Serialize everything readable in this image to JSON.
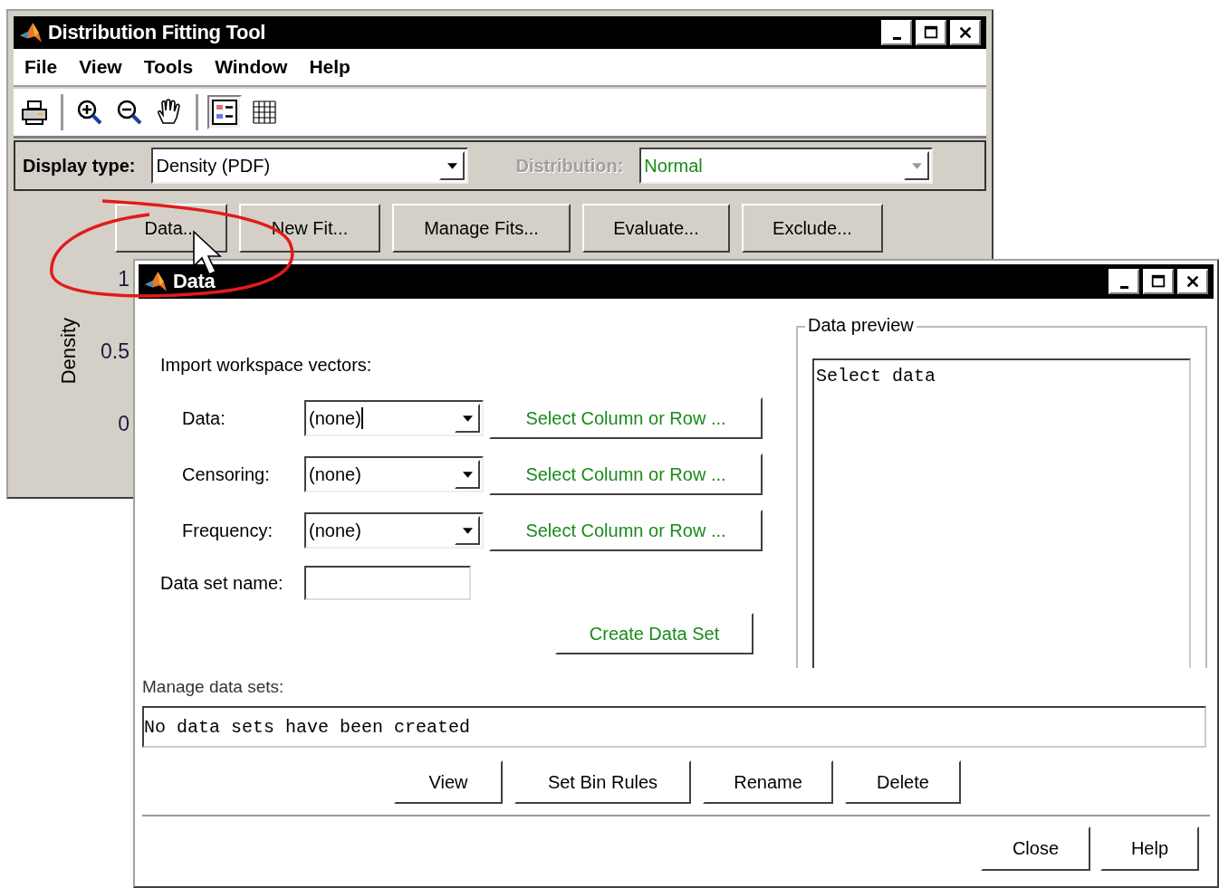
{
  "main_window": {
    "title": "Distribution Fitting Tool",
    "menu": [
      "File",
      "View",
      "Tools",
      "Window",
      "Help"
    ],
    "toolbar": [
      [
        {
          "kind": "print",
          "pressed": false
        }
      ],
      [
        {
          "kind": "zoom_in",
          "pressed": false
        },
        {
          "kind": "zoom_out",
          "pressed": false
        },
        {
          "kind": "pan",
          "pressed": false
        }
      ],
      [
        {
          "kind": "legend",
          "pressed": true
        },
        {
          "kind": "grid",
          "pressed": false
        }
      ]
    ],
    "display_type": {
      "label": "Display type:",
      "value": "Density (PDF)",
      "disabled": false
    },
    "distribution": {
      "label": "Distribution:",
      "value": "Normal",
      "disabled": true
    },
    "buttons": [
      "Data...",
      "New Fit...",
      "Manage Fits...",
      "Evaluate...",
      "Exclude..."
    ],
    "plot": {
      "ylabel": "Density",
      "yticks": [
        "1",
        "0.5",
        "0"
      ]
    }
  },
  "data_window": {
    "title": "Data",
    "import_label": "Import workspace vectors:",
    "vectors": [
      {
        "label": "Data:",
        "value": "(none)",
        "focused": true,
        "button": "Select Column or Row ..."
      },
      {
        "label": "Censoring:",
        "value": "(none)",
        "focused": false,
        "button": "Select Column or Row ..."
      },
      {
        "label": "Frequency:",
        "value": "(none)",
        "focused": false,
        "button": "Select Column or Row ..."
      }
    ],
    "name_field": {
      "label": "Data set name:"
    },
    "create_button": "Create Data Set",
    "preview": {
      "title": "Data preview",
      "text": "Select data"
    },
    "manage_label": "Manage data sets:",
    "data_sets_list": "No data sets have been created",
    "manage_buttons": [
      "View",
      "Set Bin Rules",
      "Rename",
      "Delete"
    ],
    "dialog_buttons": [
      "Close",
      "Help"
    ]
  }
}
